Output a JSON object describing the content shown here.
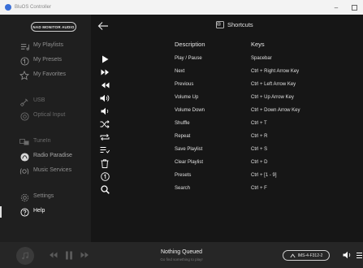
{
  "window": {
    "title": "BluOS Controller"
  },
  "logo": {
    "text": "NAD MONITOR AUDIO"
  },
  "sidebar": {
    "items": [
      {
        "label": "My Playlists",
        "icon": "playlists-icon"
      },
      {
        "label": "My Presets",
        "icon": "presets-icon"
      },
      {
        "label": "My Favorites",
        "icon": "star-icon"
      },
      {
        "label": "USB",
        "icon": "usb-icon"
      },
      {
        "label": "Optical Input",
        "icon": "optical-icon"
      },
      {
        "label": "TuneIn",
        "icon": "tunein-icon"
      },
      {
        "label": "Radio Paradise",
        "icon": "radio-paradise-icon"
      },
      {
        "label": "Music Services",
        "icon": "music-services-icon"
      },
      {
        "label": "Settings",
        "icon": "gear-icon"
      },
      {
        "label": "Help",
        "icon": "help-icon"
      }
    ]
  },
  "header": {
    "title": "Shortcuts"
  },
  "columns": {
    "description": "Description",
    "keys": "Keys"
  },
  "shortcuts": [
    {
      "description": "Play / Pause",
      "keys": "Spacebar",
      "icon": "play-icon"
    },
    {
      "description": "Next",
      "keys": "Ctrl + Right Arrow Key",
      "icon": "next-icon"
    },
    {
      "description": "Previous",
      "keys": "Ctrl + Left Arrow Key",
      "icon": "previous-icon"
    },
    {
      "description": "Volume Up",
      "keys": "Ctrl + Up Arrow Key",
      "icon": "volume-up-icon"
    },
    {
      "description": "Volume Down",
      "keys": "Ctrl + Down Arrow Key",
      "icon": "volume-down-icon"
    },
    {
      "description": "Shuffle",
      "keys": "Ctrl + T",
      "icon": "shuffle-icon"
    },
    {
      "description": "Repeat",
      "keys": "Ctrl + R",
      "icon": "repeat-icon"
    },
    {
      "description": "Save Playlist",
      "keys": "Ctrl + S",
      "icon": "save-playlist-icon"
    },
    {
      "description": "Clear Playlist",
      "keys": "Ctrl + D",
      "icon": "trash-icon"
    },
    {
      "description": "Presets",
      "keys": "Ctrl + [1 - 9]",
      "icon": "preset-number-icon"
    },
    {
      "description": "Search",
      "keys": "Ctrl + F",
      "icon": "search-icon"
    }
  ],
  "player": {
    "title": "Nothing Queued",
    "subtitle": "Go find something to play!",
    "device": "IMS-4-F312-2"
  },
  "colors": {
    "background": "#161616",
    "sidebar": "#1f1f1f",
    "player": "#262626",
    "text": "#e0e0e0"
  }
}
